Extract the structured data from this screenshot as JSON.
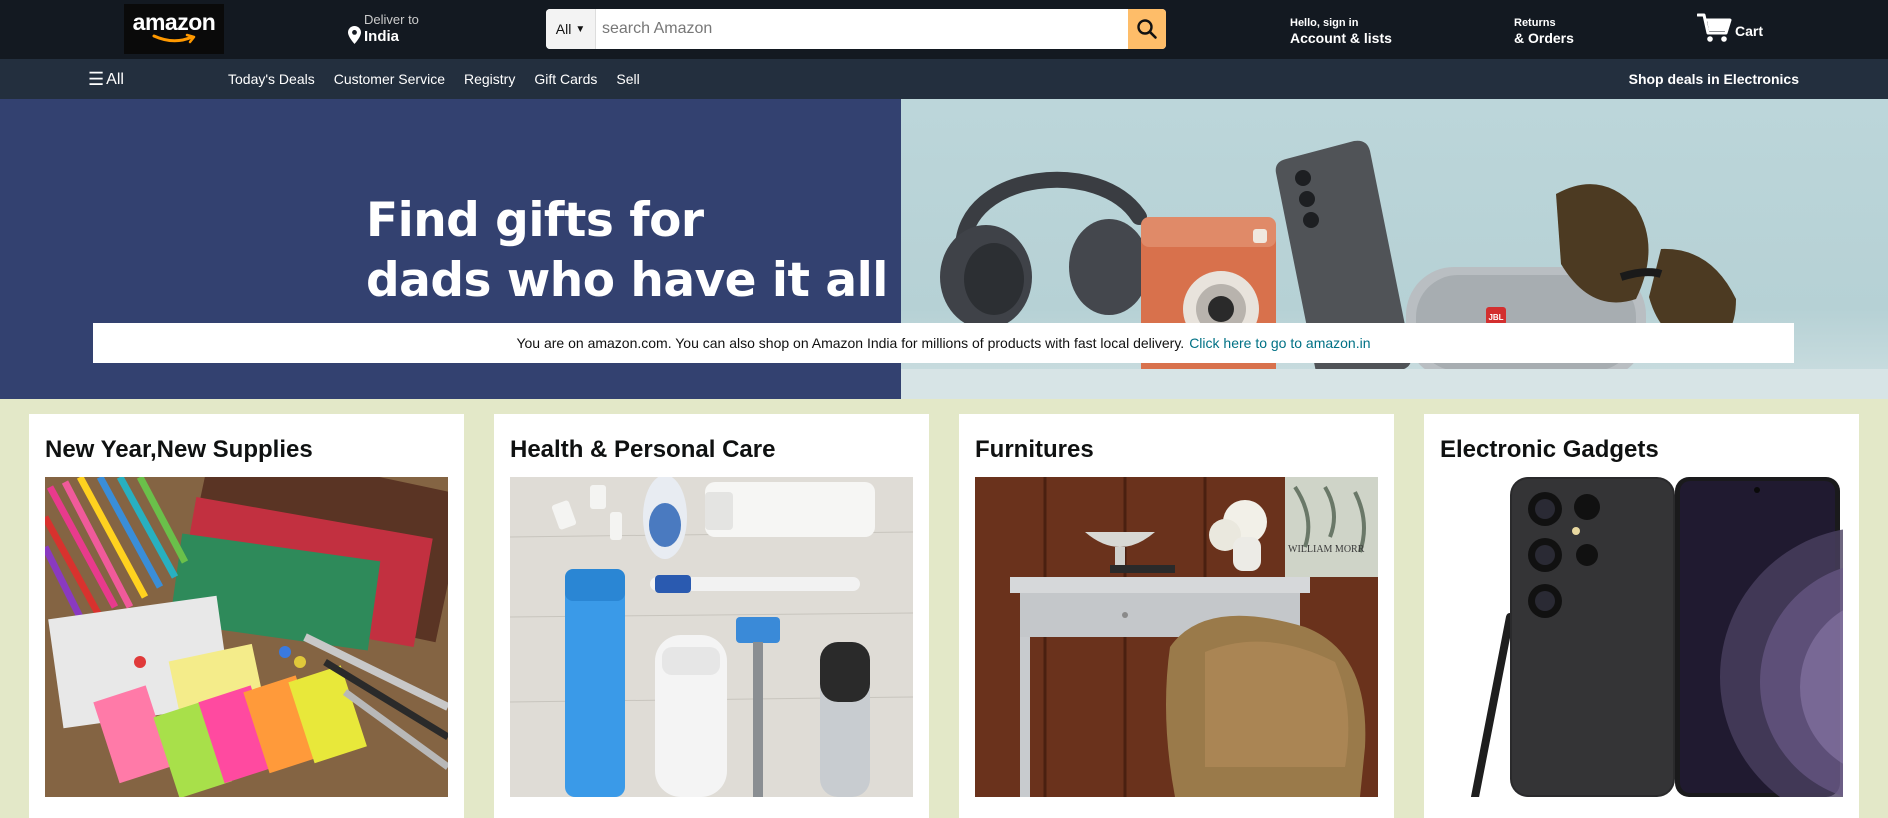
{
  "header": {
    "logo_text": "amazon",
    "deliver_label": "Deliver to",
    "deliver_location": "India",
    "search": {
      "category": "All",
      "placeholder": "search Amazon"
    },
    "account_line1": "Hello, sign in",
    "account_line2": "Account & lists",
    "orders_line1": "Returns",
    "orders_line2": "& Orders",
    "cart_label": "Cart"
  },
  "subnav": {
    "all_label": "All",
    "links": [
      "Today's Deals",
      "Customer Service",
      "Registry",
      "Gift Cards",
      "Sell"
    ],
    "promo": "Shop deals in Electronics"
  },
  "hero": {
    "title_line1": "Find gifts for",
    "title_line2": "dads who have it all",
    "brand_on_speaker": "JBL"
  },
  "notice": {
    "text": "You are on amazon.com. You can also shop on Amazon India for millions of products with fast local delivery.",
    "link": "Click here to go to amazon.in"
  },
  "cards": [
    {
      "title": "New Year,New Supplies",
      "image": "stationery-supplies"
    },
    {
      "title": "Health & Personal Care",
      "image": "personal-care-products"
    },
    {
      "title": "Furnitures",
      "image": "desk-and-chair",
      "poster_text": "WILLIAM MORR"
    },
    {
      "title": "Electronic Gadgets",
      "image": "smartphone-with-stylus"
    }
  ],
  "colors": {
    "nav_top": "#131921",
    "nav_sub": "#232f3e",
    "search_button": "#febd69",
    "hero_left": "#334170",
    "link": "#007185",
    "cards_background": "#e3e8c8"
  }
}
